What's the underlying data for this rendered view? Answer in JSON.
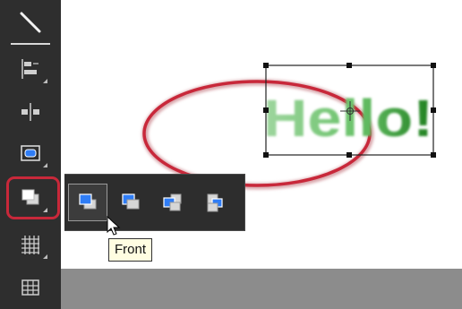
{
  "canvas": {
    "text_object": "Hello!",
    "ellipse_color": "#c8283a",
    "text_color": "#2e8b2e",
    "selection_color": "#222222"
  },
  "toolbar": {
    "tools": [
      {
        "name": "line-tool",
        "icon": "line-icon"
      },
      {
        "name": "align-tool",
        "icon": "align-icon"
      },
      {
        "name": "distribute-tool",
        "icon": "distribute-icon"
      },
      {
        "name": "shape-tool",
        "icon": "rect-shape-icon"
      },
      {
        "name": "arrange-tool",
        "icon": "bring-to-front-icon",
        "highlighted": true
      },
      {
        "name": "grid-tool",
        "icon": "grid-icon"
      },
      {
        "name": "table-tool",
        "icon": "table-icon"
      }
    ],
    "highlight_color": "#c8283a"
  },
  "flyout": {
    "items": [
      {
        "name": "front",
        "icon": "bring-to-front-icon",
        "selected": true
      },
      {
        "name": "back",
        "icon": "send-to-back-icon"
      },
      {
        "name": "forward",
        "icon": "bring-forward-icon"
      },
      {
        "name": "backward",
        "icon": "send-backward-icon"
      }
    ]
  },
  "tooltip": {
    "text": "Front"
  }
}
